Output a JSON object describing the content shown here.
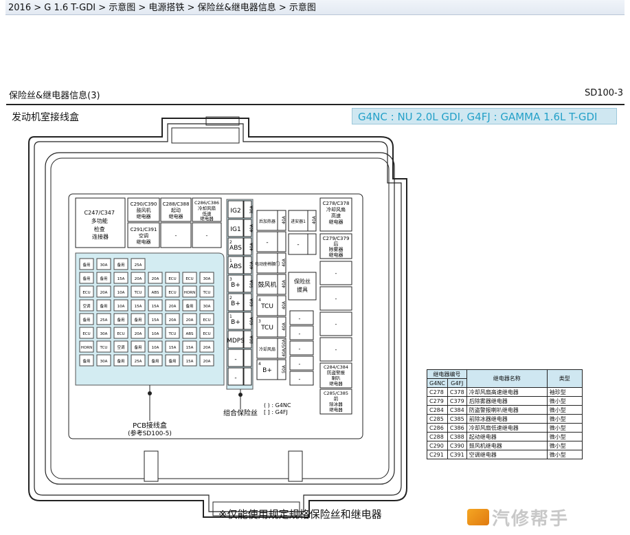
{
  "breadcrumb": "2016 > G 1.6 T-GDI > 示意图 > 电源搭铁 > 保险丝&继电器信息 > 示意图",
  "doc": {
    "title": "保险丝&继电器信息(3)",
    "code": "SD100-3",
    "section": "发动机室接线盒",
    "engine": "G4NC : NU 2.0L GDI, G4FJ : GAMMA 1.6L T-GDI",
    "warning": "※仅能使用规定规格保险丝和继电器",
    "watermark": "汽修帮手"
  },
  "labels": {
    "c247": [
      "C247/C347",
      "多功能",
      "检查",
      "连接器"
    ],
    "c290": [
      "C290/C390",
      "鼓风机",
      "继电器"
    ],
    "c288": [
      "C288/C388",
      "起动",
      "继电器"
    ],
    "c286": [
      "C286/C386",
      "冷却风扇",
      "低速",
      "继电器"
    ],
    "c291": [
      "C291/C391",
      "空调",
      "继电器"
    ],
    "c278": [
      "C278/C378",
      "冷却风扇",
      "高速",
      "继电器"
    ],
    "c279": [
      "C279/C379",
      "后",
      "除雾器",
      "继电器"
    ],
    "c284": [
      "C284/C384",
      "防盗警报",
      "喇叭",
      "继电器"
    ],
    "c285": [
      "C285/C385",
      "前",
      "除冰器",
      "继电器"
    ],
    "fuse_puller": [
      "保险丝",
      "拔具"
    ],
    "pcb": [
      "PCB接线盒",
      "(参考SD100-5)"
    ],
    "multi_fuse": "组合保险丝",
    "legend": [
      "( ) : G4NC",
      "[ ] : G4FJ"
    ],
    "dash": "-"
  },
  "multi_fuses": [
    {
      "name": "IG2",
      "amp": "30A"
    },
    {
      "name": "IG1",
      "amp": "40A"
    },
    {
      "name": "ABS",
      "amp": "40A",
      "sup": "2"
    },
    {
      "name": "ABS",
      "amp": "40A",
      "sup": "1"
    },
    {
      "name": "B+",
      "amp": "50A",
      "sup": "3"
    },
    {
      "name": "B+",
      "amp": "60A",
      "sup": "2"
    },
    {
      "name": "B+",
      "amp": "60A",
      "sup": "1"
    },
    {
      "name": "MDPS",
      "amp": "80A"
    },
    {
      "name": "-",
      "amp": ""
    },
    {
      "name": "-",
      "amp": ""
    }
  ],
  "mid_fuses": [
    {
      "name": "后加热器",
      "amp": "40A"
    },
    {
      "name": "-",
      "amp": ""
    },
    {
      "name": "电动座椅腰门",
      "amp": "40A"
    },
    {
      "name": "鼓风机",
      "amp": "40A"
    },
    {
      "name": "TCU",
      "amp": "40A",
      "sup": "4"
    },
    {
      "name": "TCU",
      "amp": "40A",
      "sup": "3"
    },
    {
      "name": "冷却风扇",
      "amp": "40A/50A"
    },
    {
      "name": "B+",
      "amp": "50A",
      "sup": "4"
    }
  ],
  "right_fuses": [
    {
      "name": "进安器1",
      "amp": "40A"
    },
    {
      "name": "-",
      "amp": ""
    }
  ],
  "pcb_cells": [
    "备用",
    "30A",
    "备用",
    "25A",
    "备用",
    "备用",
    "15A",
    "20A",
    "20A",
    "ECU",
    "ECU",
    "30A",
    "ECU",
    "20A",
    "10A",
    "TCU",
    "ABS",
    "ECU",
    "HORN",
    "TCU",
    "空调",
    "备用",
    "10A",
    "15A",
    "15A",
    "20A"
  ],
  "relay_table": {
    "header": {
      "no": "继电器编号",
      "g4nc": "G4NC",
      "g4fj": "G4FJ",
      "name": "继电器名称",
      "type": "类型"
    },
    "rows": [
      {
        "a": "C278",
        "b": "C378",
        "name": "冷却风扇高速继电器",
        "type": "袖珍型"
      },
      {
        "a": "C279",
        "b": "C379",
        "name": "后除雾器继电器",
        "type": "微小型"
      },
      {
        "a": "C284",
        "b": "C384",
        "name": "防盗警报喇叭继电器",
        "type": "微小型"
      },
      {
        "a": "C285",
        "b": "C385",
        "name": "前除冰器继电器",
        "type": "微小型"
      },
      {
        "a": "C286",
        "b": "C386",
        "name": "冷却风扇低速继电器",
        "type": "微小型"
      },
      {
        "a": "C288",
        "b": "C388",
        "name": "起动继电器",
        "type": "微小型"
      },
      {
        "a": "C290",
        "b": "C390",
        "name": "鼓风机继电器",
        "type": "微小型"
      },
      {
        "a": "C291",
        "b": "C391",
        "name": "空调继电器",
        "type": "微小型"
      }
    ]
  },
  "colors": {
    "blue_fill": "#d3ecf2",
    "engine_text": "#23a0c8",
    "banner": "#cfe7f1"
  }
}
